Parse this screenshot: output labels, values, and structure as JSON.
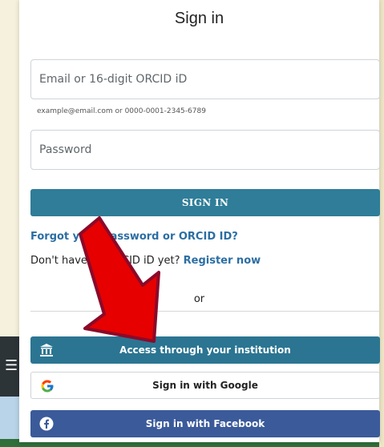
{
  "dialog": {
    "title": "Sign in",
    "email_placeholder": "Email or 16-digit ORCID iD",
    "email_hint": "example@email.com or 0000-0001-2345-6789",
    "password_placeholder": "Password",
    "signin_button": "SIGN IN",
    "forgot_link": "Forgot your password or ORCID ID?",
    "register_prompt": "Don't have an ORCID iD yet?",
    "register_link": "Register now",
    "or_label": "or"
  },
  "sso": {
    "institution_label": "Access through your institution",
    "google_label": "Sign in with Google",
    "facebook_label": "Sign in with Facebook"
  },
  "background": {
    "menu_glyph": "☰"
  },
  "colors": {
    "primary": "#2f7d98",
    "link": "#2b6ea3",
    "facebook": "#3b5a9a",
    "arrow": "#e60000"
  }
}
